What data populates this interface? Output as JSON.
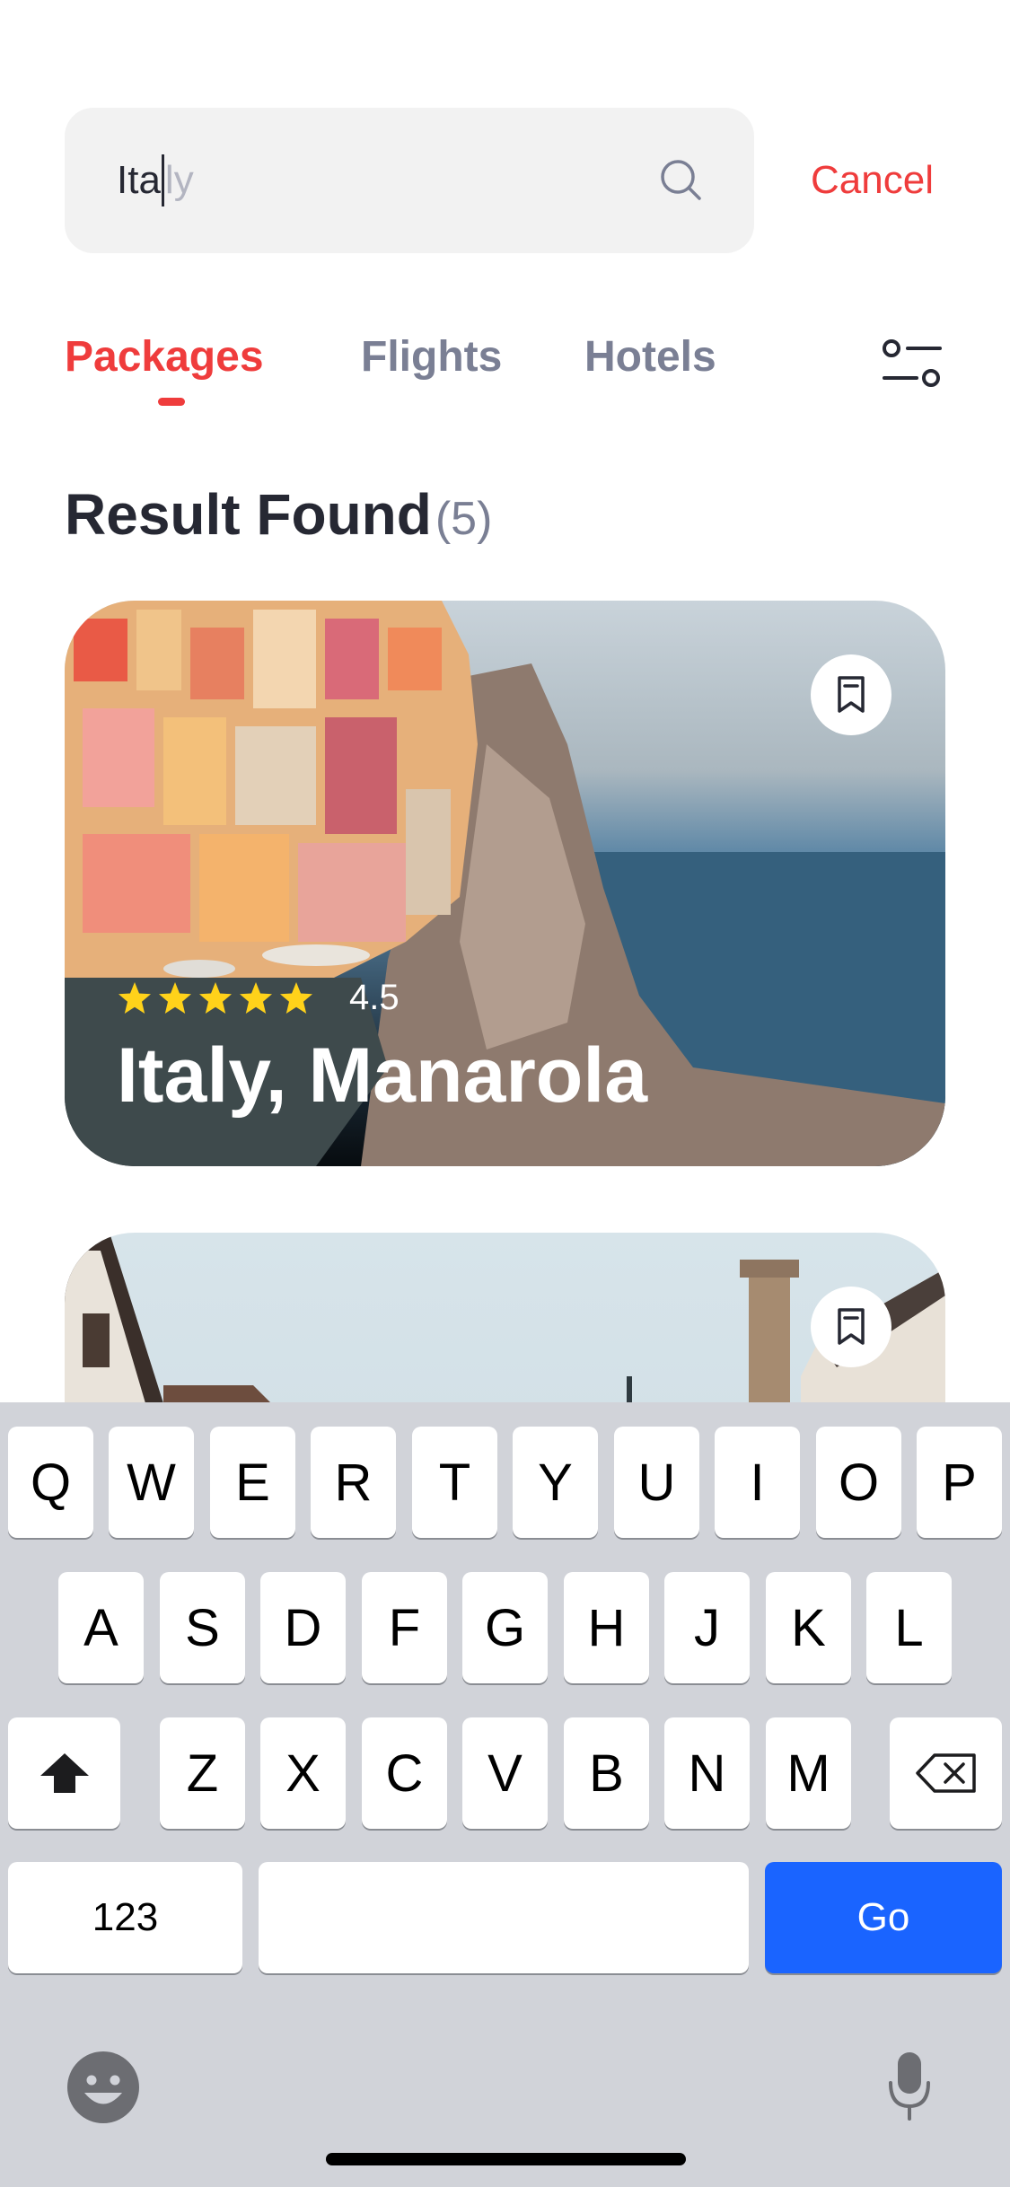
{
  "search": {
    "typed_text": "Ita",
    "suggestion_text": "ly",
    "icon": "search-icon",
    "cancel_label": "Cancel"
  },
  "tabs": [
    {
      "label": "Packages",
      "active": true
    },
    {
      "label": "Flights",
      "active": false
    },
    {
      "label": "Hotels",
      "active": false
    }
  ],
  "filter_icon": "filter-icon",
  "results": {
    "title": "Result Found",
    "count": "(5)"
  },
  "cards": [
    {
      "title": "Italy, Manarola",
      "rating": "4.5",
      "stars": 5,
      "bookmark_icon": "bookmark-icon"
    },
    {
      "bookmark_icon": "bookmark-icon"
    }
  ],
  "keyboard": {
    "row1": [
      "Q",
      "W",
      "E",
      "R",
      "T",
      "Y",
      "U",
      "I",
      "O",
      "P"
    ],
    "row2": [
      "A",
      "S",
      "D",
      "F",
      "G",
      "H",
      "J",
      "K",
      "L"
    ],
    "row3": [
      "Z",
      "X",
      "C",
      "V",
      "B",
      "N",
      "M"
    ],
    "numbers_label": "123",
    "go_label": "Go",
    "shift_icon": "shift-icon",
    "backspace_icon": "backspace-icon",
    "emoji_icon": "emoji-icon",
    "mic_icon": "microphone-icon"
  },
  "colors": {
    "accent": "#ef3c3c",
    "go_button": "#1a64ff",
    "star": "#ffd21a",
    "tab_inactive": "#7a7f94"
  }
}
